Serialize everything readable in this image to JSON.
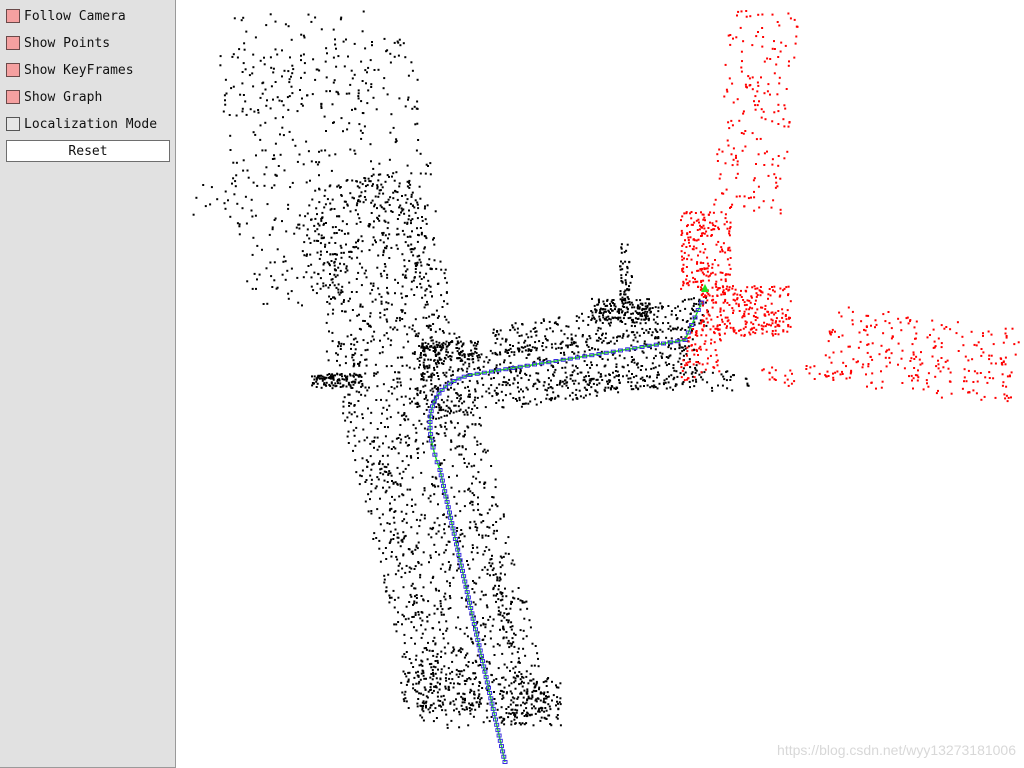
{
  "panel": {
    "options": [
      {
        "label": "Follow Camera",
        "checked": true
      },
      {
        "label": "Show Points",
        "checked": true
      },
      {
        "label": "Show KeyFrames",
        "checked": true
      },
      {
        "label": "Show Graph",
        "checked": true
      },
      {
        "label": "Localization Mode",
        "checked": false
      }
    ],
    "reset_label": "Reset"
  },
  "watermark": "https://blog.csdn.net/wyy13273181006",
  "colors": {
    "panel_bg": "#e1e1e1",
    "checkbox_on": "#f5a0a0",
    "map_points": "#000000",
    "local_map_points": "#ff0000",
    "keyframes": "#3b2fe0",
    "covisibility_graph": "#22dd22",
    "current_camera": "#22dd22"
  }
}
